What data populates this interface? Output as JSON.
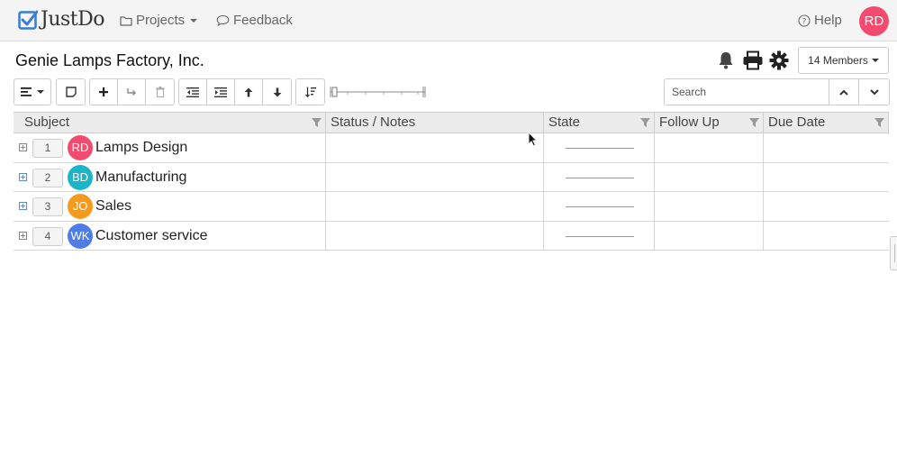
{
  "navbar": {
    "brand": "JustDo",
    "projects_label": "Projects",
    "feedback_label": "Feedback",
    "help_label": "Help",
    "user_initials": "RD"
  },
  "header": {
    "project_title": "Genie Lamps Factory, Inc.",
    "members_label": "14 Members"
  },
  "search": {
    "placeholder": "Search"
  },
  "columns": [
    {
      "label": "Subject"
    },
    {
      "label": "Status / Notes"
    },
    {
      "label": "State"
    },
    {
      "label": "Follow Up"
    },
    {
      "label": "Due Date"
    }
  ],
  "rows": [
    {
      "seq": "1",
      "initials": "RD",
      "title": "Lamps Design",
      "avatar_color": "#f24b6f"
    },
    {
      "seq": "2",
      "initials": "BD",
      "title": "Manufacturing",
      "avatar_color": "#1ab5c6"
    },
    {
      "seq": "3",
      "initials": "JO",
      "title": "Sales",
      "avatar_color": "#f59a1b"
    },
    {
      "seq": "4",
      "initials": "WK",
      "title": "Customer service",
      "avatar_color": "#4f7de6"
    }
  ],
  "colors": {
    "brand_blue": "#3a7bd5",
    "avatar_user": "#f24b6f"
  },
  "icons": [
    "check-logo-icon",
    "folder-icon",
    "comment-icon",
    "help-circle-icon",
    "bell-icon",
    "print-icon",
    "gear-icon",
    "align-left-icon",
    "note-icon",
    "plus-icon",
    "redo-icon",
    "trash-icon",
    "outdent-icon",
    "indent-icon",
    "arrow-up-icon",
    "arrow-down-icon",
    "sort-icon",
    "filter-icon",
    "chevron-up-icon",
    "chevron-down-icon"
  ]
}
